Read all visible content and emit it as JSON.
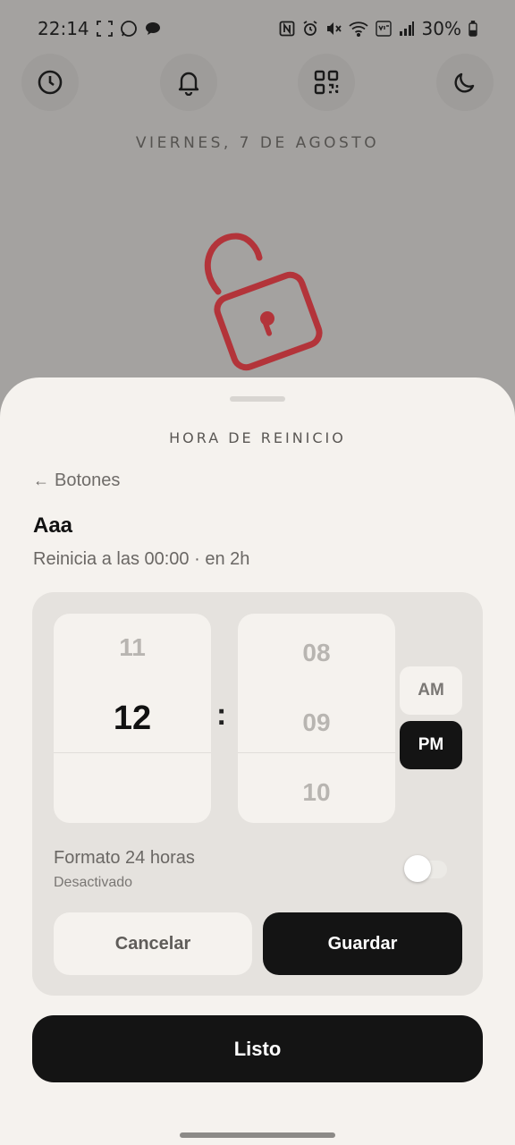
{
  "status_bar": {
    "time": "22:14",
    "battery": "30%",
    "icons_left": [
      "screenshot-icon",
      "whatsapp-icon",
      "chat-bubble-icon"
    ],
    "icons_right": [
      "nfc-icon",
      "alarm-icon",
      "mute-icon",
      "wifi-icon",
      "volte-icon",
      "signal-icon",
      "battery-icon"
    ]
  },
  "quick_actions": [
    "clock-icon",
    "bell-icon",
    "qr-code-icon",
    "moon-icon"
  ],
  "date": "VIERNES, 7 DE AGOSTO",
  "lock_color": "#b3343a",
  "sheet": {
    "title": "HORA DE REINICIO",
    "back_label": "Botones",
    "back_arrow": "←",
    "item_name": "Aaa",
    "reset_info": "Reinicia a las 00:00 · en 2h",
    "picker": {
      "hour_prev": "11",
      "hour_selected": "12",
      "separator": ":",
      "minute_prev": "08",
      "minute_selected": "09",
      "minute_next": "10",
      "am_label": "AM",
      "pm_label": "PM",
      "selected_period": "PM"
    },
    "format_label": "Formato 24 horas",
    "format_status": "Desactivado",
    "format_enabled": false,
    "cancel_label": "Cancelar",
    "save_label": "Guardar",
    "done_label": "Listo"
  },
  "colors": {
    "background_dim": "#a4a2a0",
    "sheet": "#f5f2ee",
    "panel": "#e5e2de",
    "primary_button": "#141414",
    "accent_lock": "#b3343a"
  }
}
